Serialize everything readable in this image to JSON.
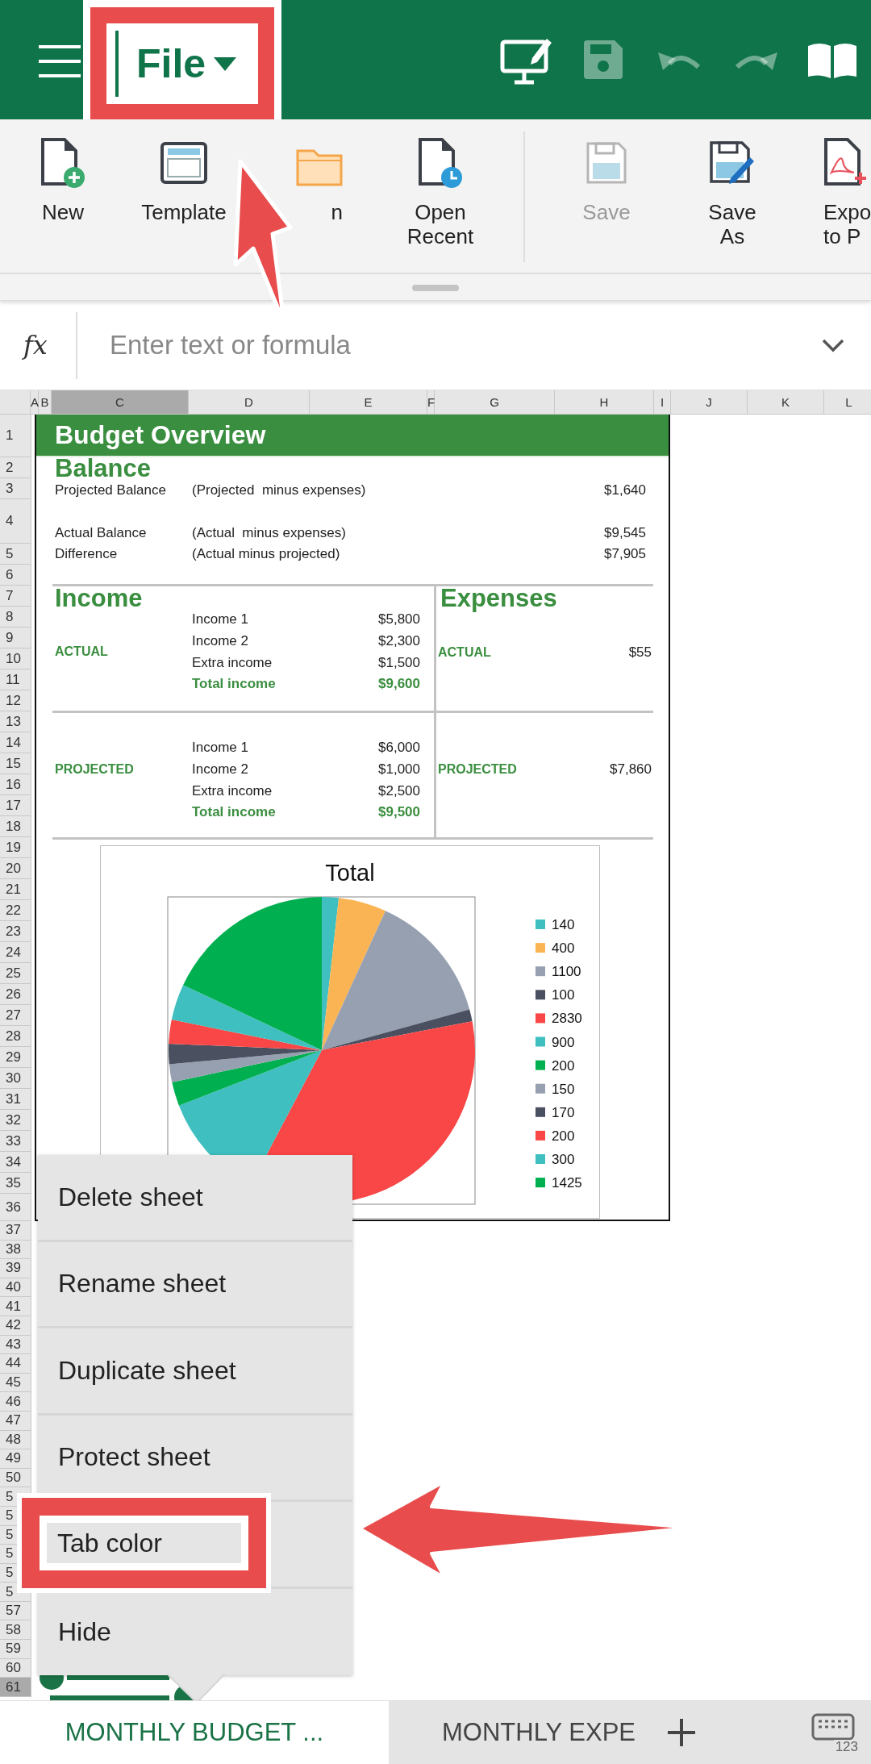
{
  "app_bar": {
    "file_menu": {
      "label": "File",
      "highlighted": true
    },
    "actions": [
      {
        "kind": "edit_mode",
        "disabled": false
      },
      {
        "kind": "save",
        "disabled": true
      },
      {
        "kind": "undo",
        "disabled": true
      },
      {
        "kind": "redo",
        "disabled": true
      },
      {
        "kind": "read_mode",
        "disabled": false
      }
    ]
  },
  "ribbon": {
    "groups": [
      [
        {
          "kind": "new",
          "label": "New",
          "disabled": false
        },
        {
          "kind": "template",
          "label": "Template",
          "disabled": false
        },
        {
          "kind": "open",
          "label": "n",
          "disabled": false
        },
        {
          "kind": "open_recent",
          "label": "Open\nRecent",
          "disabled": false
        }
      ],
      [
        {
          "kind": "save",
          "label": "Save",
          "disabled": true
        },
        {
          "kind": "save_as",
          "label": "Save\nAs",
          "disabled": false
        },
        {
          "kind": "export_pdf",
          "label": "Expo\nto P",
          "disabled": false
        }
      ]
    ]
  },
  "formula_bar": {
    "label": "fx",
    "placeholder": "Enter text or formula"
  },
  "columns": [
    {
      "label": "A",
      "selected": false
    },
    {
      "label": "B",
      "selected": false
    },
    {
      "label": "C",
      "selected": true
    },
    {
      "label": "D",
      "selected": false
    },
    {
      "label": "E",
      "selected": false
    },
    {
      "label": "F",
      "selected": false
    },
    {
      "label": "G",
      "selected": false
    },
    {
      "label": "H",
      "selected": false
    },
    {
      "label": "I",
      "selected": false
    },
    {
      "label": "J",
      "selected": false
    },
    {
      "label": "K",
      "selected": false
    },
    {
      "label": "L",
      "selected": false
    }
  ],
  "rows": [
    {
      "label": "1",
      "selected": false
    },
    {
      "label": "2",
      "selected": false
    },
    {
      "label": "3",
      "selected": false
    },
    {
      "label": "4",
      "selected": false
    },
    {
      "label": "5",
      "selected": false
    },
    {
      "label": "6",
      "selected": false
    },
    {
      "label": "7",
      "selected": false
    },
    {
      "label": "8",
      "selected": false
    },
    {
      "label": "9",
      "selected": false
    },
    {
      "label": "10",
      "selected": false
    },
    {
      "label": "11",
      "selected": false
    },
    {
      "label": "12",
      "selected": false
    },
    {
      "label": "13",
      "selected": false
    },
    {
      "label": "14",
      "selected": false
    },
    {
      "label": "15",
      "selected": false
    },
    {
      "label": "16",
      "selected": false
    },
    {
      "label": "17",
      "selected": false
    },
    {
      "label": "18",
      "selected": false
    },
    {
      "label": "19",
      "selected": false
    },
    {
      "label": "20",
      "selected": false
    },
    {
      "label": "21",
      "selected": false
    },
    {
      "label": "22",
      "selected": false
    },
    {
      "label": "23",
      "selected": false
    },
    {
      "label": "24",
      "selected": false
    },
    {
      "label": "25",
      "selected": false
    },
    {
      "label": "26",
      "selected": false
    },
    {
      "label": "27",
      "selected": false
    },
    {
      "label": "28",
      "selected": false
    },
    {
      "label": "29",
      "selected": false
    },
    {
      "label": "30",
      "selected": false
    },
    {
      "label": "31",
      "selected": false
    },
    {
      "label": "32",
      "selected": false
    },
    {
      "label": "33",
      "selected": false
    },
    {
      "label": "34",
      "selected": false
    },
    {
      "label": "35",
      "selected": false
    },
    {
      "label": "36",
      "selected": false
    },
    {
      "label": "37",
      "selected": false
    },
    {
      "label": "38",
      "selected": false
    },
    {
      "label": "39",
      "selected": false
    },
    {
      "label": "40",
      "selected": false
    },
    {
      "label": "41",
      "selected": false
    },
    {
      "label": "42",
      "selected": false
    },
    {
      "label": "43",
      "selected": false
    },
    {
      "label": "44",
      "selected": false
    },
    {
      "label": "45",
      "selected": false
    },
    {
      "label": "46",
      "selected": false
    },
    {
      "label": "47",
      "selected": false
    },
    {
      "label": "48",
      "selected": false
    },
    {
      "label": "49",
      "selected": false
    },
    {
      "label": "50",
      "selected": false
    },
    {
      "label": "5",
      "selected": false
    },
    {
      "label": "5",
      "selected": false
    },
    {
      "label": "5",
      "selected": false
    },
    {
      "label": "5",
      "selected": false
    },
    {
      "label": "5",
      "selected": false
    },
    {
      "label": "5",
      "selected": false
    },
    {
      "label": "57",
      "selected": false
    },
    {
      "label": "58",
      "selected": false
    },
    {
      "label": "59",
      "selected": false
    },
    {
      "label": "60",
      "selected": false
    },
    {
      "label": "61",
      "selected": true
    }
  ],
  "sheet": {
    "title": "Budget Overview",
    "balance": {
      "heading": "Balance",
      "rows": [
        {
          "label": "Projected Balance",
          "note": "(Projected  minus expenses)",
          "value": "$1,640"
        },
        {
          "label": "Actual Balance",
          "note": "(Actual  minus expenses)",
          "value": "$9,545"
        },
        {
          "label": "Difference",
          "note": "(Actual minus projected)",
          "value": "$7,905"
        }
      ]
    },
    "income": {
      "heading": "Income",
      "blocks": [
        {
          "label": "ACTUAL",
          "lines": [
            {
              "label": "Income 1",
              "value": "$5,800",
              "total": false
            },
            {
              "label": "Income 2",
              "value": "$2,300",
              "total": false
            },
            {
              "label": "Extra income",
              "value": "$1,500",
              "total": false
            },
            {
              "label": "Total income",
              "value": "$9,600",
              "total": true
            }
          ]
        },
        {
          "label": "PROJECTED",
          "lines": [
            {
              "label": "Income 1",
              "value": "$6,000",
              "total": false
            },
            {
              "label": "Income 2",
              "value": "$1,000",
              "total": false
            },
            {
              "label": "Extra income",
              "value": "$2,500",
              "total": false
            },
            {
              "label": "Total income",
              "value": "$9,500",
              "total": true
            }
          ]
        }
      ]
    },
    "expenses": {
      "heading": "Expenses",
      "blocks": [
        {
          "label": "ACTUAL",
          "value": "$55"
        },
        {
          "label": "PROJECTED",
          "value": "$7,860"
        }
      ]
    },
    "chart": {
      "slices": [
        {
          "color": "#3fbfbf"
        },
        {
          "color": "#fbb454"
        },
        {
          "color": "#96a0b1"
        },
        {
          "color": "#4a5060"
        },
        {
          "color": "#f94646"
        },
        {
          "color": "#3fbfbf"
        },
        {
          "color": "#00b050"
        },
        {
          "color": "#96a0b1"
        },
        {
          "color": "#4a5060"
        },
        {
          "color": "#f94646"
        },
        {
          "color": "#3fbfbf"
        },
        {
          "color": "#00b050"
        }
      ],
      "chart_data": {
        "type": "pie",
        "title": "Total",
        "legend": "right",
        "categories": [
          "140",
          "400",
          "1100",
          "100",
          "2830",
          "900",
          "200",
          "150",
          "170",
          "200",
          "300",
          "1425"
        ],
        "values": [
          140,
          400,
          1100,
          100,
          2830,
          900,
          200,
          150,
          170,
          200,
          300,
          1425
        ]
      }
    }
  },
  "context_menu": {
    "items": [
      {
        "label": "Delete sheet",
        "highlighted": false
      },
      {
        "label": "Rename sheet",
        "highlighted": false
      },
      {
        "label": "Duplicate sheet",
        "highlighted": false
      },
      {
        "label": "Protect sheet",
        "highlighted": false
      },
      {
        "label": "Tab color",
        "highlighted": true
      },
      {
        "label": "Hide",
        "highlighted": false
      }
    ]
  },
  "sheet_tabs": [
    {
      "label": "MONTHLY BUDGET ...",
      "selected": true
    },
    {
      "label": "MONTHLY EXPE",
      "selected": false
    }
  ],
  "keyboard_button": {
    "label": "123"
  }
}
